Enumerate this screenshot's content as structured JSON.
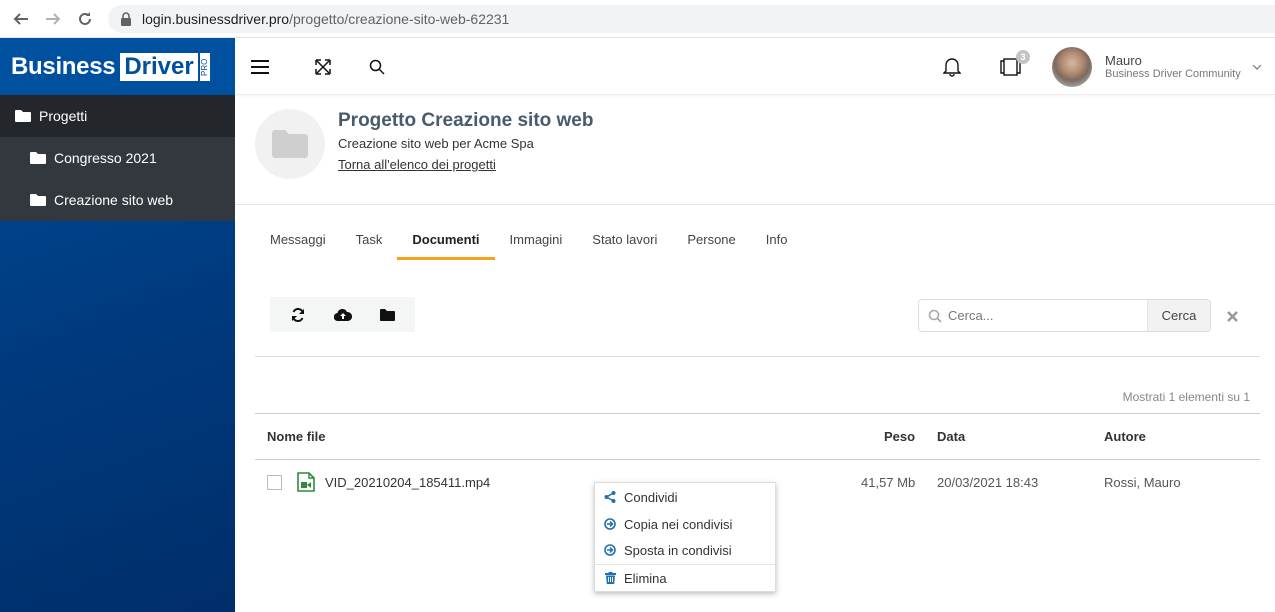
{
  "browser": {
    "url_host": "login.businessdriver.pro",
    "url_path": "/progetto/creazione-sito-web-62231"
  },
  "brand": {
    "word1": "Business",
    "word2": "Driver",
    "suffix": "PRO",
    "color": "#0050a0"
  },
  "sidebar": {
    "items": [
      {
        "label": "Progetti",
        "level": "top"
      },
      {
        "label": "Congresso 2021",
        "level": "sub"
      },
      {
        "label": "Creazione sito web",
        "level": "sub"
      }
    ]
  },
  "topbar": {
    "notifications_badge": "3",
    "user_name": "Mauro",
    "user_org": "Business Driver Community"
  },
  "project": {
    "title": "Progetto Creazione sito web",
    "subtitle": "Creazione sito web per Acme Spa",
    "back_link": "Torna all'elenco dei progetti"
  },
  "tabs": [
    {
      "label": "Messaggi",
      "active": false
    },
    {
      "label": "Task",
      "active": false
    },
    {
      "label": "Documenti",
      "active": true
    },
    {
      "label": "Immagini",
      "active": false
    },
    {
      "label": "Stato lavori",
      "active": false
    },
    {
      "label": "Persone",
      "active": false
    },
    {
      "label": "Info",
      "active": false
    }
  ],
  "toolbar": {
    "search_placeholder": "Cerca...",
    "search_button": "Cerca"
  },
  "list": {
    "count_text": "Mostrati 1 elementi su 1",
    "columns": {
      "name": "Nome file",
      "size": "Peso",
      "date": "Data",
      "author": "Autore"
    },
    "rows": [
      {
        "name": "VID_20210204_185411.mp4",
        "size": "41,57 Mb",
        "date": "20/03/2021 18:43",
        "author": "Rossi, Mauro"
      }
    ]
  },
  "context_menu": {
    "items": [
      {
        "label": "Condividi",
        "icon": "share-icon"
      },
      {
        "label": "Copia nei condivisi",
        "icon": "arrow-circle-right-icon"
      },
      {
        "label": "Sposta in condivisi",
        "icon": "arrow-circle-right-icon"
      },
      {
        "label": "Elimina",
        "icon": "trash-icon"
      }
    ],
    "icon_color": "#1f6fb2"
  },
  "colors": {
    "tab_active_underline": "#f5a31a",
    "sidebar_top": "#23272c",
    "sidebar_sub": "#32383e",
    "file_icon": "#2e8b3a"
  }
}
